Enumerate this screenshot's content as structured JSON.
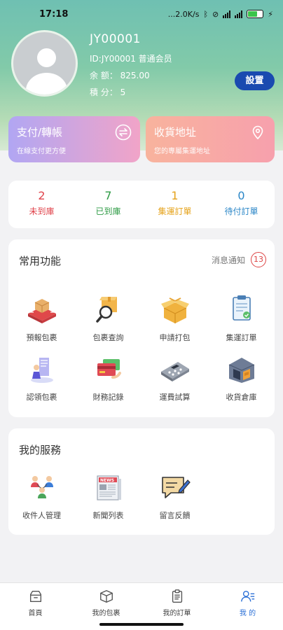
{
  "status_bar": {
    "time": "17:18",
    "network_speed": "...2.0K/s",
    "battery": "80"
  },
  "profile": {
    "name": "JY00001",
    "id_line": "ID:JY00001 普通会员",
    "balance_line": "余 额： 825.00",
    "points_line": "積 分： 5",
    "settings_label": "設置"
  },
  "cards": {
    "pay": {
      "title": "支付/轉帳",
      "subtitle": "在線支付更方便",
      "icon": "exchange-icon"
    },
    "address": {
      "title": "收貨地址",
      "subtitle": "您的專屬集運地址",
      "icon": "location-pin-icon"
    }
  },
  "stats": [
    {
      "count": "2",
      "label": "未到庫",
      "color": "#e0434b"
    },
    {
      "count": "7",
      "label": "已到庫",
      "color": "#2e9b45"
    },
    {
      "count": "1",
      "label": "集運訂單",
      "color": "#e5a21a"
    },
    {
      "count": "0",
      "label": "待付訂單",
      "color": "#2a86c7"
    }
  ],
  "common_functions": {
    "title": "常用功能",
    "notice_label": "消息通知",
    "notice_count": "13",
    "items": [
      {
        "label": "預報包裹",
        "icon": "parcel-forecast-icon"
      },
      {
        "label": "包裹查詢",
        "icon": "parcel-search-icon"
      },
      {
        "label": "申請打包",
        "icon": "packing-icon"
      },
      {
        "label": "集運訂單",
        "icon": "clipboard-icon"
      },
      {
        "label": "認領包裹",
        "icon": "claim-parcel-icon"
      },
      {
        "label": "財務記錄",
        "icon": "finance-card-icon"
      },
      {
        "label": "運費試算",
        "icon": "calculator-icon"
      },
      {
        "label": "收貨倉庫",
        "icon": "warehouse-icon"
      }
    ]
  },
  "my_services": {
    "title": "我的服務",
    "items": [
      {
        "label": "收件人管理",
        "icon": "recipients-icon"
      },
      {
        "label": "新聞列表",
        "icon": "news-icon"
      },
      {
        "label": "留言反饋",
        "icon": "feedback-icon"
      }
    ]
  },
  "tabbar": [
    {
      "label": "首頁",
      "icon": "home-icon"
    },
    {
      "label": "我的包裹",
      "icon": "box-icon"
    },
    {
      "label": "我的訂單",
      "icon": "orders-icon"
    },
    {
      "label": "我 的",
      "icon": "profile-icon",
      "active": true
    }
  ]
}
